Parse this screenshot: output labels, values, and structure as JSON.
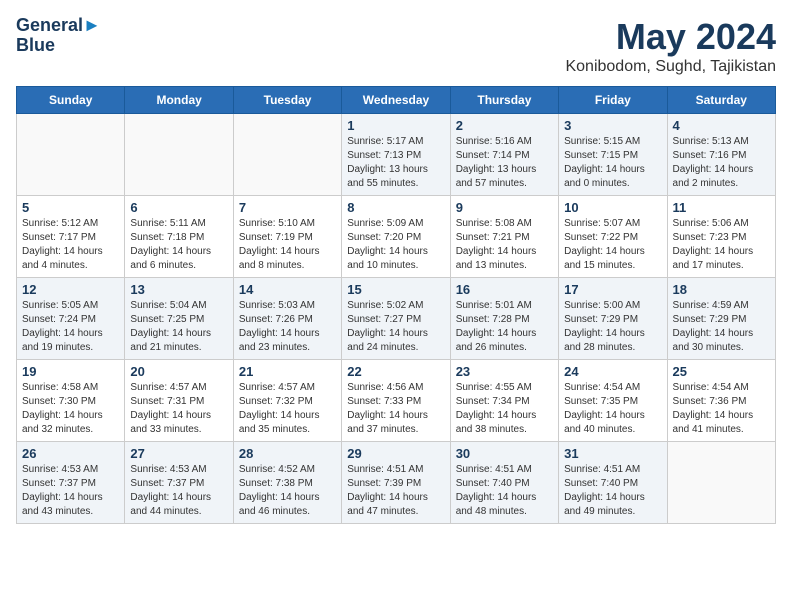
{
  "header": {
    "logo_line1": "General",
    "logo_line2": "Blue",
    "title": "May 2024",
    "subtitle": "Konibodom, Sughd, Tajikistan"
  },
  "calendar": {
    "days_of_week": [
      "Sunday",
      "Monday",
      "Tuesday",
      "Wednesday",
      "Thursday",
      "Friday",
      "Saturday"
    ],
    "weeks": [
      [
        {
          "day": "",
          "info": ""
        },
        {
          "day": "",
          "info": ""
        },
        {
          "day": "",
          "info": ""
        },
        {
          "day": "1",
          "info": "Sunrise: 5:17 AM\nSunset: 7:13 PM\nDaylight: 13 hours\nand 55 minutes."
        },
        {
          "day": "2",
          "info": "Sunrise: 5:16 AM\nSunset: 7:14 PM\nDaylight: 13 hours\nand 57 minutes."
        },
        {
          "day": "3",
          "info": "Sunrise: 5:15 AM\nSunset: 7:15 PM\nDaylight: 14 hours\nand 0 minutes."
        },
        {
          "day": "4",
          "info": "Sunrise: 5:13 AM\nSunset: 7:16 PM\nDaylight: 14 hours\nand 2 minutes."
        }
      ],
      [
        {
          "day": "5",
          "info": "Sunrise: 5:12 AM\nSunset: 7:17 PM\nDaylight: 14 hours\nand 4 minutes."
        },
        {
          "day": "6",
          "info": "Sunrise: 5:11 AM\nSunset: 7:18 PM\nDaylight: 14 hours\nand 6 minutes."
        },
        {
          "day": "7",
          "info": "Sunrise: 5:10 AM\nSunset: 7:19 PM\nDaylight: 14 hours\nand 8 minutes."
        },
        {
          "day": "8",
          "info": "Sunrise: 5:09 AM\nSunset: 7:20 PM\nDaylight: 14 hours\nand 10 minutes."
        },
        {
          "day": "9",
          "info": "Sunrise: 5:08 AM\nSunset: 7:21 PM\nDaylight: 14 hours\nand 13 minutes."
        },
        {
          "day": "10",
          "info": "Sunrise: 5:07 AM\nSunset: 7:22 PM\nDaylight: 14 hours\nand 15 minutes."
        },
        {
          "day": "11",
          "info": "Sunrise: 5:06 AM\nSunset: 7:23 PM\nDaylight: 14 hours\nand 17 minutes."
        }
      ],
      [
        {
          "day": "12",
          "info": "Sunrise: 5:05 AM\nSunset: 7:24 PM\nDaylight: 14 hours\nand 19 minutes."
        },
        {
          "day": "13",
          "info": "Sunrise: 5:04 AM\nSunset: 7:25 PM\nDaylight: 14 hours\nand 21 minutes."
        },
        {
          "day": "14",
          "info": "Sunrise: 5:03 AM\nSunset: 7:26 PM\nDaylight: 14 hours\nand 23 minutes."
        },
        {
          "day": "15",
          "info": "Sunrise: 5:02 AM\nSunset: 7:27 PM\nDaylight: 14 hours\nand 24 minutes."
        },
        {
          "day": "16",
          "info": "Sunrise: 5:01 AM\nSunset: 7:28 PM\nDaylight: 14 hours\nand 26 minutes."
        },
        {
          "day": "17",
          "info": "Sunrise: 5:00 AM\nSunset: 7:29 PM\nDaylight: 14 hours\nand 28 minutes."
        },
        {
          "day": "18",
          "info": "Sunrise: 4:59 AM\nSunset: 7:29 PM\nDaylight: 14 hours\nand 30 minutes."
        }
      ],
      [
        {
          "day": "19",
          "info": "Sunrise: 4:58 AM\nSunset: 7:30 PM\nDaylight: 14 hours\nand 32 minutes."
        },
        {
          "day": "20",
          "info": "Sunrise: 4:57 AM\nSunset: 7:31 PM\nDaylight: 14 hours\nand 33 minutes."
        },
        {
          "day": "21",
          "info": "Sunrise: 4:57 AM\nSunset: 7:32 PM\nDaylight: 14 hours\nand 35 minutes."
        },
        {
          "day": "22",
          "info": "Sunrise: 4:56 AM\nSunset: 7:33 PM\nDaylight: 14 hours\nand 37 minutes."
        },
        {
          "day": "23",
          "info": "Sunrise: 4:55 AM\nSunset: 7:34 PM\nDaylight: 14 hours\nand 38 minutes."
        },
        {
          "day": "24",
          "info": "Sunrise: 4:54 AM\nSunset: 7:35 PM\nDaylight: 14 hours\nand 40 minutes."
        },
        {
          "day": "25",
          "info": "Sunrise: 4:54 AM\nSunset: 7:36 PM\nDaylight: 14 hours\nand 41 minutes."
        }
      ],
      [
        {
          "day": "26",
          "info": "Sunrise: 4:53 AM\nSunset: 7:37 PM\nDaylight: 14 hours\nand 43 minutes."
        },
        {
          "day": "27",
          "info": "Sunrise: 4:53 AM\nSunset: 7:37 PM\nDaylight: 14 hours\nand 44 minutes."
        },
        {
          "day": "28",
          "info": "Sunrise: 4:52 AM\nSunset: 7:38 PM\nDaylight: 14 hours\nand 46 minutes."
        },
        {
          "day": "29",
          "info": "Sunrise: 4:51 AM\nSunset: 7:39 PM\nDaylight: 14 hours\nand 47 minutes."
        },
        {
          "day": "30",
          "info": "Sunrise: 4:51 AM\nSunset: 7:40 PM\nDaylight: 14 hours\nand 48 minutes."
        },
        {
          "day": "31",
          "info": "Sunrise: 4:51 AM\nSunset: 7:40 PM\nDaylight: 14 hours\nand 49 minutes."
        },
        {
          "day": "",
          "info": ""
        }
      ]
    ]
  }
}
